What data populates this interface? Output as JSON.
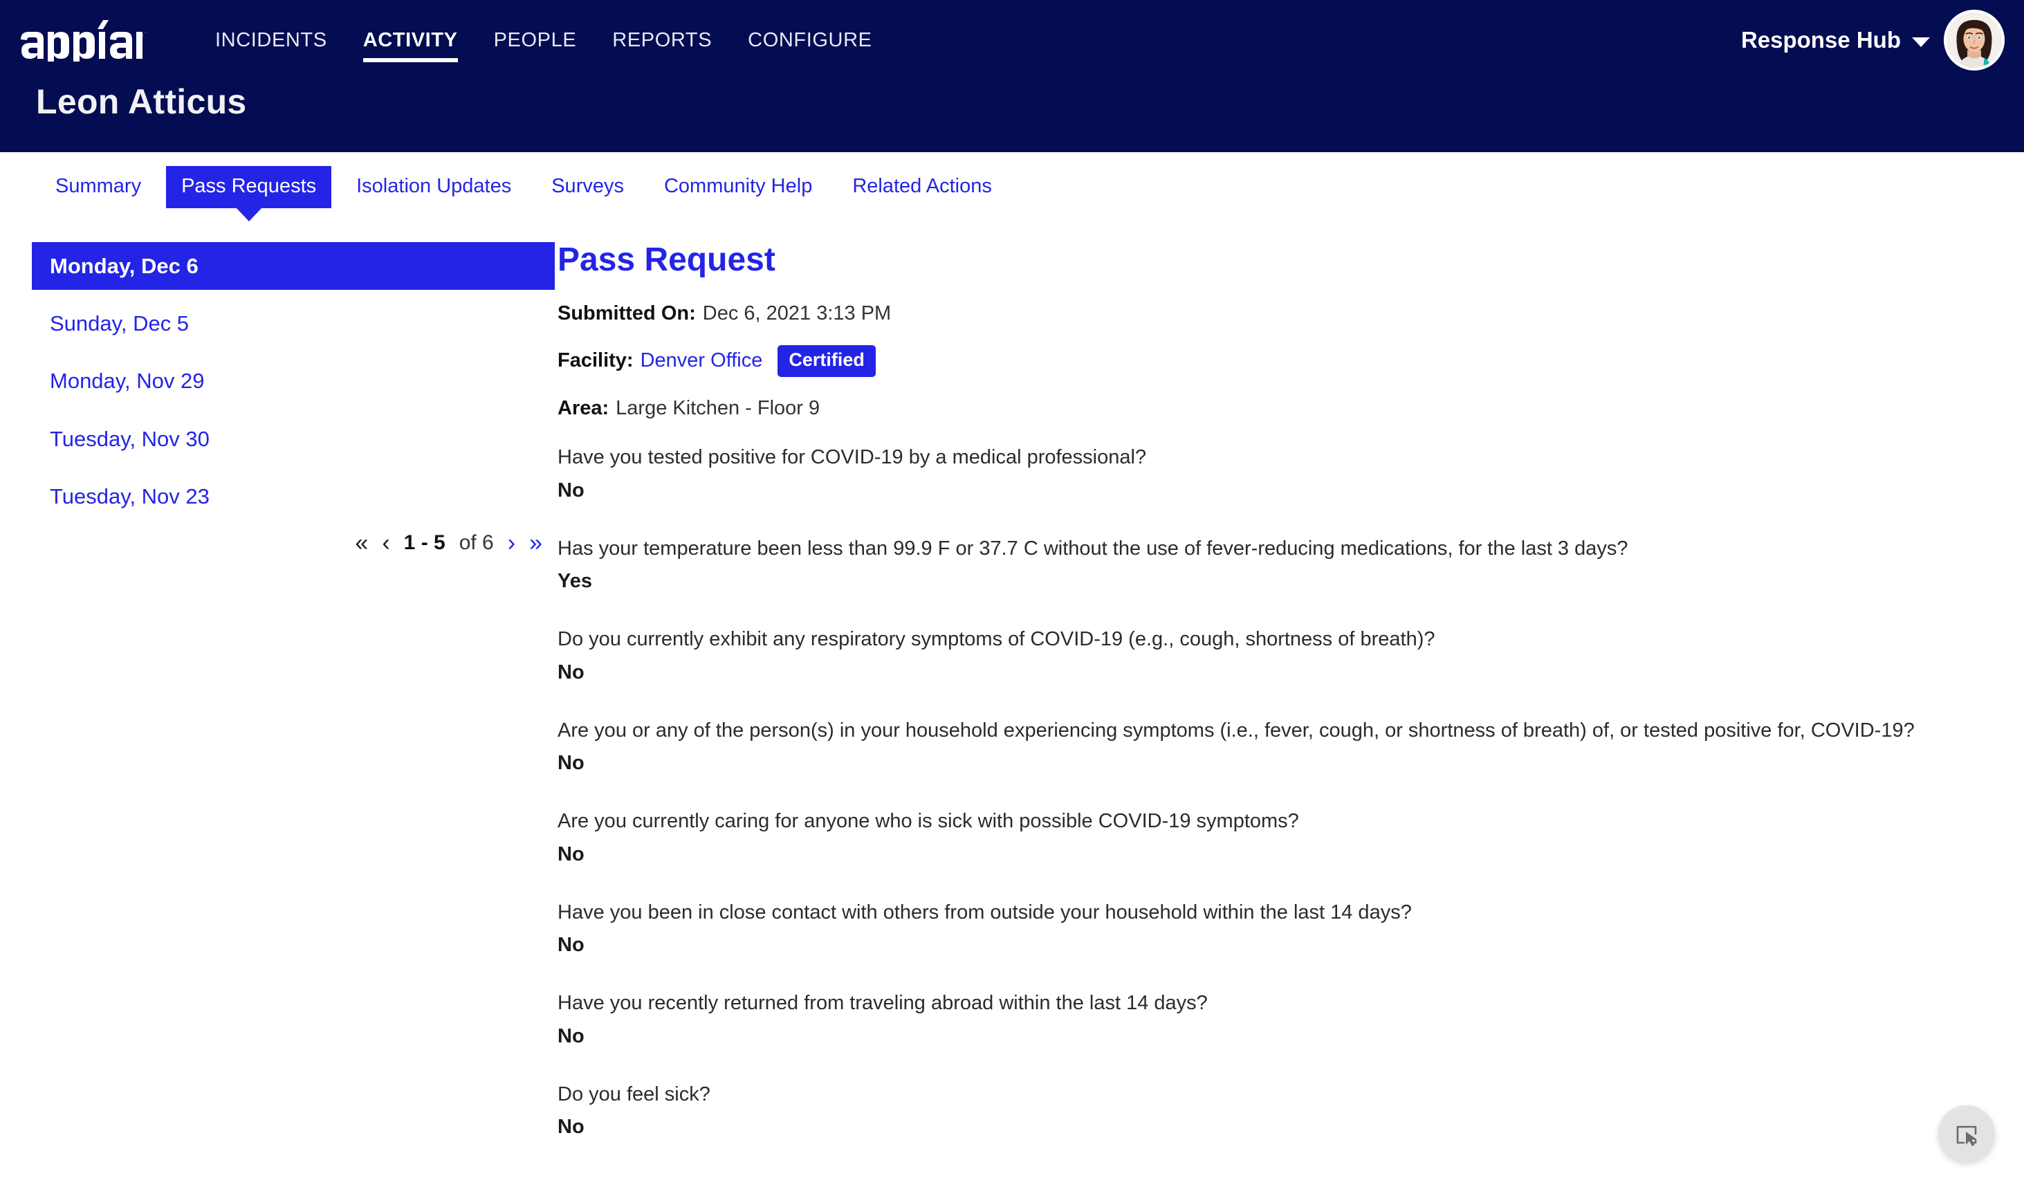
{
  "header": {
    "logo_text": "appian",
    "nav_items": [
      {
        "label": "INCIDENTS",
        "active": false
      },
      {
        "label": "ACTIVITY",
        "active": true
      },
      {
        "label": "PEOPLE",
        "active": false
      },
      {
        "label": "REPORTS",
        "active": false
      },
      {
        "label": "CONFIGURE",
        "active": false
      }
    ],
    "hub_name": "Response Hub",
    "page_title": "Leon Atticus"
  },
  "tabs": [
    {
      "label": "Summary",
      "active": false
    },
    {
      "label": "Pass Requests",
      "active": true
    },
    {
      "label": "Isolation Updates",
      "active": false
    },
    {
      "label": "Surveys",
      "active": false
    },
    {
      "label": "Community Help",
      "active": false
    },
    {
      "label": "Related Actions",
      "active": false
    }
  ],
  "sidebar": {
    "items": [
      {
        "label": "Monday, Dec 6",
        "selected": true
      },
      {
        "label": "Sunday, Dec 5",
        "selected": false
      },
      {
        "label": "Monday, Nov 29",
        "selected": false
      },
      {
        "label": "Tuesday, Nov 30",
        "selected": false
      },
      {
        "label": "Tuesday, Nov 23",
        "selected": false
      }
    ],
    "pagination": {
      "first_icon": "«",
      "prev_icon": "‹",
      "range": "1 - 5",
      "of_text": "of 6",
      "next_icon": "›",
      "last_icon": "»"
    }
  },
  "detail": {
    "title": "Pass Request",
    "submitted_on_label": "Submitted On:",
    "submitted_on_value": "Dec 6, 2021 3:13 PM",
    "facility_label": "Facility:",
    "facility_value": "Denver Office",
    "status_badge": "Certified",
    "area_label": "Area:",
    "area_value": "Large Kitchen - Floor 9",
    "questions": [
      {
        "question": "Have you tested positive for COVID-19 by a medical professional?",
        "answer": "No"
      },
      {
        "question": "Has your temperature been less than 99.9 F or 37.7 C without the use of fever-reducing medications, for the last 3 days?",
        "answer": "Yes"
      },
      {
        "question": "Do you currently exhibit any respiratory symptoms of COVID-19 (e.g., cough, shortness of breath)?",
        "answer": "No"
      },
      {
        "question": "Are you or any of the person(s) in your household experiencing symptoms (i.e., fever, cough, or shortness of breath) of, or tested positive for, COVID-19?",
        "answer": "No"
      },
      {
        "question": "Are you currently caring for anyone who is sick with possible COVID-19 symptoms?",
        "answer": "No"
      },
      {
        "question": "Have you been in close contact with others from outside your household within the last 14 days?",
        "answer": "No"
      },
      {
        "question": "Have you recently returned from traveling abroad within the last 14 days?",
        "answer": "No"
      },
      {
        "question": "Do you feel sick?",
        "answer": "No"
      }
    ]
  },
  "colors": {
    "navy": "#040c52",
    "accent_blue": "#2424e6",
    "text_dark": "#222222",
    "white": "#ffffff",
    "fab_bg": "#e3e3e3"
  }
}
